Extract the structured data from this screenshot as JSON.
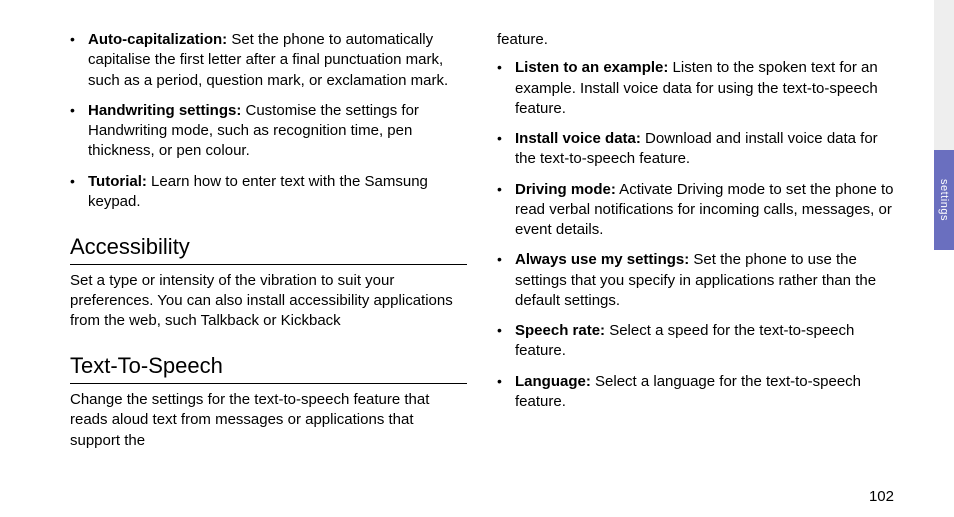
{
  "page_number": "102",
  "side_tab_label": "settings",
  "left": {
    "bullets1": [
      {
        "term": "Auto-capitalization:",
        "text": " Set the phone to automatically capitalise the first letter after a final punctuation mark, such as a period, question mark, or exclamation mark."
      },
      {
        "term": "Handwriting settings:",
        "text": " Customise the settings for Handwriting mode, such as recognition time, pen thickness, or pen colour."
      },
      {
        "term": "Tutorial:",
        "text": " Learn how to enter text with the Samsung keypad."
      }
    ],
    "heading_accessibility": "Accessibility",
    "desc_accessibility": "Set a type or intensity of the vibration to suit your preferences. You can also install accessibility applications from the web, such Talkback or Kickback",
    "heading_tts": "Text-To-Speech",
    "desc_tts": "Change the settings for the text-to-speech feature that reads aloud text from messages or applications that support the"
  },
  "right": {
    "cont": "feature.",
    "bullets2": [
      {
        "term": "Listen to an example:",
        "text": " Listen to the spoken text for an example. Install voice data for using the text-to-speech feature."
      },
      {
        "term": "Install voice data:",
        "text": " Download and install voice data for the text-to-speech feature."
      },
      {
        "term": "Driving mode:",
        "text": " Activate Driving mode to set the phone to read verbal notifications for incoming calls, messages, or event details."
      },
      {
        "term": "Always use my settings:",
        "text": " Set the phone to use the settings that you specify in applications rather than the default settings."
      },
      {
        "term": "Speech rate:",
        "text": " Select a speed for the text-to-speech feature."
      },
      {
        "term": "Language:",
        "text": " Select a language for the text-to-speech feature."
      }
    ]
  }
}
